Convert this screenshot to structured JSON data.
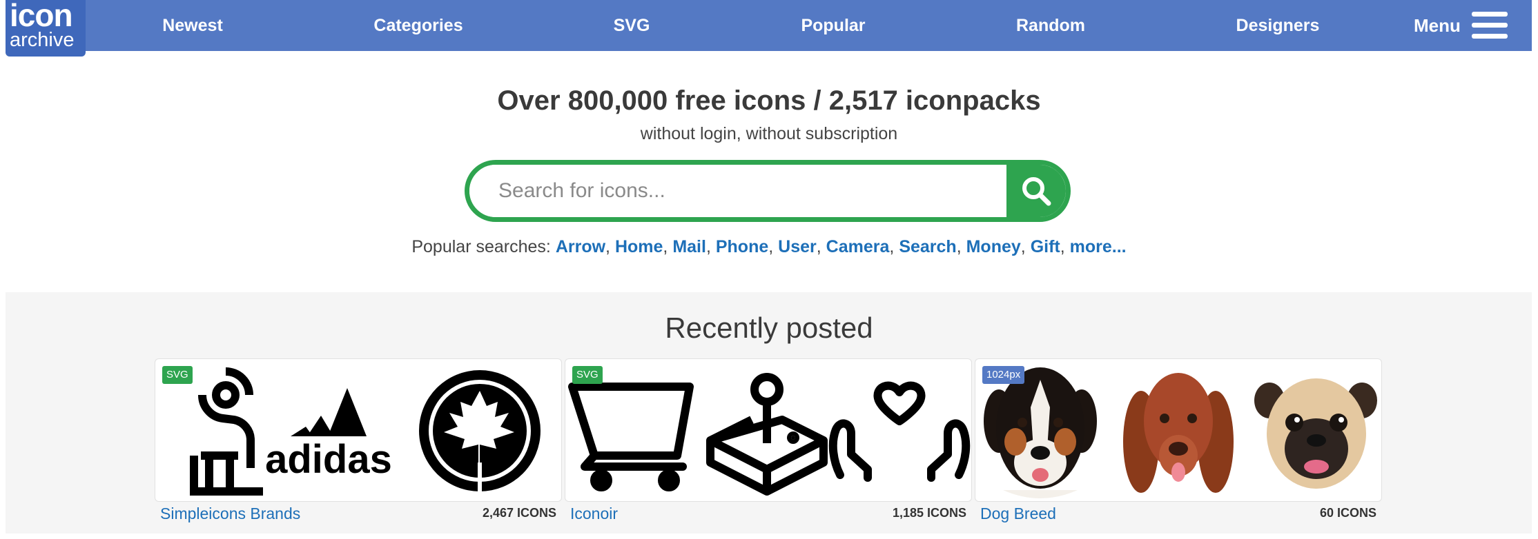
{
  "logo": {
    "line1": "icon",
    "line2": "archive"
  },
  "nav": {
    "items": [
      {
        "label": "Newest"
      },
      {
        "label": "Categories"
      },
      {
        "label": "SVG"
      },
      {
        "label": "Popular"
      },
      {
        "label": "Random"
      },
      {
        "label": "Designers"
      }
    ],
    "menu_label": "Menu"
  },
  "hero": {
    "headline": "Over 800,000 free icons / 2,517 iconpacks",
    "subheadline": "without login, without subscription",
    "search_placeholder": "Search for icons..."
  },
  "popular_searches": {
    "label": "Popular searches:",
    "links": [
      "Arrow",
      "Home",
      "Mail",
      "Phone",
      "User",
      "Camera",
      "Search",
      "Money",
      "Gift",
      "more..."
    ]
  },
  "recent": {
    "title": "Recently posted",
    "packs": [
      {
        "badge": "SVG",
        "name": "Simpleicons Brands",
        "count": "2,467 ICONS",
        "icons": [
          "sponsors-icon",
          "adidas-logo-icon",
          "maple-leaf-icon"
        ]
      },
      {
        "badge": "SVG",
        "name": "Iconoir",
        "count": "1,185 ICONS",
        "icons": [
          "shopping-cart-icon",
          "joystick-icon",
          "hands-heart-icon"
        ]
      },
      {
        "badge": "1024px",
        "name": "Dog Breed",
        "count": "60 ICONS",
        "icons": [
          "bernese-dog-icon",
          "setter-dog-icon",
          "pug-dog-icon"
        ]
      }
    ]
  },
  "colors": {
    "nav_bg": "#5479c4",
    "logo_bg": "#3f68bb",
    "accent_green": "#2ea44f",
    "link_blue": "#1d6fb8"
  }
}
